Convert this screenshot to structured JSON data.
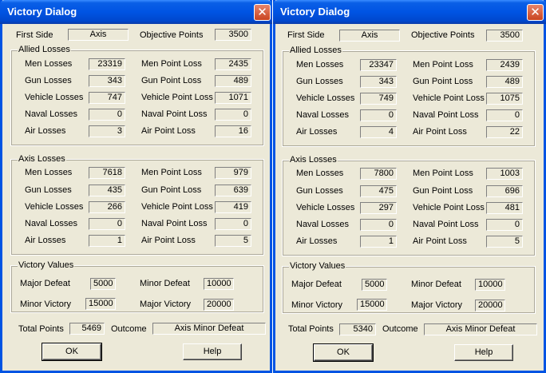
{
  "dialogs": [
    {
      "title": "Victory Dialog",
      "close": "✕",
      "first_side_label": "First Side",
      "first_side_value": "Axis",
      "objective_points_label": "Objective Points",
      "objective_points_value": "3500",
      "allied_group": "Allied Losses",
      "axis_group": "Axis Losses",
      "labels": {
        "men_losses": "Men Losses",
        "gun_losses": "Gun Losses",
        "vehicle_losses": "Vehicle Losses",
        "naval_losses": "Naval Losses",
        "air_losses": "Air Losses",
        "men_point_loss": "Men Point Loss",
        "gun_point_loss": "Gun Point Loss",
        "vehicle_point_loss": "Vehicle Point Loss",
        "naval_point_loss": "Naval Point Loss",
        "air_point_loss": "Air Point Loss"
      },
      "allied": {
        "men_losses": "23319",
        "gun_losses": "343",
        "vehicle_losses": "747",
        "naval_losses": "0",
        "air_losses": "3",
        "men_point_loss": "2435",
        "gun_point_loss": "489",
        "vehicle_point_loss": "1071",
        "naval_point_loss": "0",
        "air_point_loss": "16"
      },
      "axis": {
        "men_losses": "7618",
        "gun_losses": "435",
        "vehicle_losses": "266",
        "naval_losses": "0",
        "air_losses": "1",
        "men_point_loss": "979",
        "gun_point_loss": "639",
        "vehicle_point_loss": "419",
        "naval_point_loss": "0",
        "air_point_loss": "5"
      },
      "victory_group": "Victory Values",
      "victory": {
        "major_defeat_label": "Major Defeat",
        "major_defeat": "5000",
        "minor_defeat_label": "Minor Defeat",
        "minor_defeat": "10000",
        "minor_victory_label": "Minor Victory",
        "minor_victory": "15000",
        "major_victory_label": "Major Victory",
        "major_victory": "20000"
      },
      "total_points_label": "Total Points",
      "total_points": "5469",
      "outcome_label": "Outcome",
      "outcome": "Axis Minor Defeat",
      "ok_label": "OK",
      "help_label": "Help"
    },
    {
      "title": "Victory Dialog",
      "close": "✕",
      "first_side_label": "First Side",
      "first_side_value": "Axis",
      "objective_points_label": "Objective Points",
      "objective_points_value": "3500",
      "allied_group": "Allied Losses",
      "axis_group": "Axis Losses",
      "labels": {
        "men_losses": "Men Losses",
        "gun_losses": "Gun Losses",
        "vehicle_losses": "Vehicle Losses",
        "naval_losses": "Naval Losses",
        "air_losses": "Air Losses",
        "men_point_loss": "Men Point Loss",
        "gun_point_loss": "Gun Point Loss",
        "vehicle_point_loss": "Vehicle Point Loss",
        "naval_point_loss": "Naval Point Loss",
        "air_point_loss": "Air Point Loss"
      },
      "allied": {
        "men_losses": "23347",
        "gun_losses": "343",
        "vehicle_losses": "749",
        "naval_losses": "0",
        "air_losses": "4",
        "men_point_loss": "2439",
        "gun_point_loss": "489",
        "vehicle_point_loss": "1075",
        "naval_point_loss": "0",
        "air_point_loss": "22"
      },
      "axis": {
        "men_losses": "7800",
        "gun_losses": "475",
        "vehicle_losses": "297",
        "naval_losses": "0",
        "air_losses": "1",
        "men_point_loss": "1003",
        "gun_point_loss": "696",
        "vehicle_point_loss": "481",
        "naval_point_loss": "0",
        "air_point_loss": "5"
      },
      "victory_group": "Victory Values",
      "victory": {
        "major_defeat_label": "Major Defeat",
        "major_defeat": "5000",
        "minor_defeat_label": "Minor Defeat",
        "minor_defeat": "10000",
        "minor_victory_label": "Minor Victory",
        "minor_victory": "15000",
        "major_victory_label": "Major Victory",
        "major_victory": "20000"
      },
      "total_points_label": "Total Points",
      "total_points": "5340",
      "outcome_label": "Outcome",
      "outcome": "Axis Minor Defeat",
      "ok_label": "OK",
      "help_label": "Help"
    }
  ]
}
